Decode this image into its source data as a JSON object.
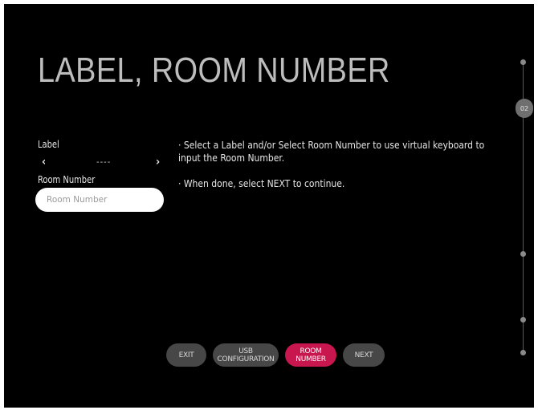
{
  "header": {
    "title": "LABEL, ROOM NUMBER"
  },
  "form": {
    "label_title": "Label",
    "label_value": "----",
    "arrow_left": "‹",
    "arrow_right": "›",
    "room_title": "Room Number",
    "room_placeholder": "Room Number",
    "room_value": ""
  },
  "instructions": [
    "· Select a Label and/or Select Room Number to use virtual keyboard to input the Room Number.",
    "· When done, select NEXT to continue."
  ],
  "nav": {
    "exit": "EXIT",
    "usb_configuration": "USB CONFIGURATION",
    "room_number": "ROOM NUMBER",
    "next": "NEXT",
    "active": "room_number"
  },
  "progress": {
    "current_step": "02"
  },
  "colors": {
    "background": "#000000",
    "accent": "#c8164e",
    "button": "#474747",
    "title": "#bdbdbd"
  }
}
